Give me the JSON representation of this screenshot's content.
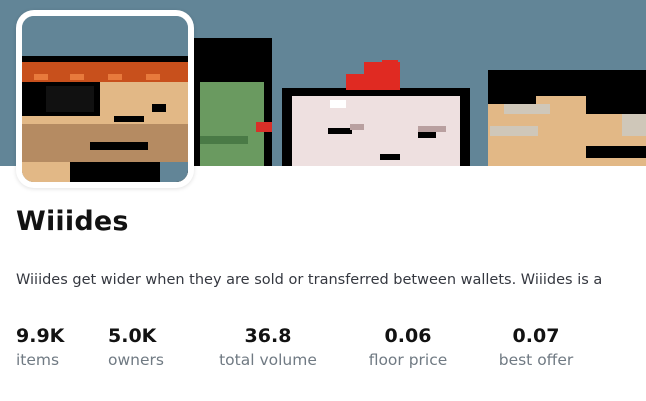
{
  "collection": {
    "name": "Wiiides",
    "description": "Wiiides get wider when they are sold or transferred between wallets. Wiiides is a"
  },
  "banner": {
    "background_color": "#628597",
    "characters": [
      "green-zombie-icon",
      "white-chicken-icon",
      "bandana-man-icon"
    ]
  },
  "avatar": {
    "icon": "pirate-wiiide-icon"
  },
  "stats": [
    {
      "value": "9.9K",
      "label": "items"
    },
    {
      "value": "5.0K",
      "label": "owners"
    },
    {
      "value": "36.8",
      "label": "total volume"
    },
    {
      "value": "0.06",
      "label": "floor price"
    },
    {
      "value": "0.07",
      "label": "best offer"
    }
  ]
}
